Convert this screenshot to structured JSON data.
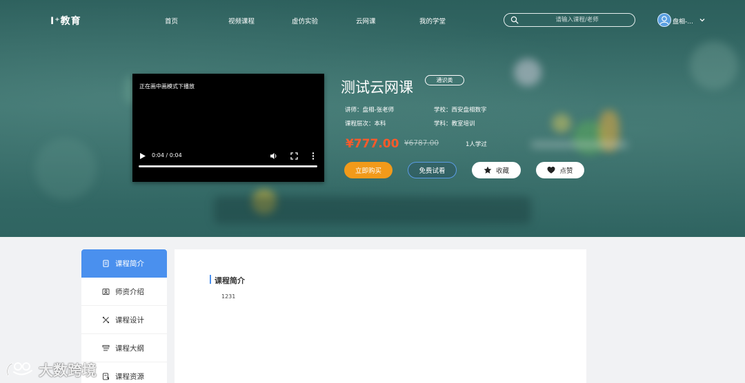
{
  "header": {
    "logo": "I⁺教育",
    "nav": [
      "首页",
      "视频课程",
      "虚仿实验",
      "云网课",
      "我的学堂"
    ],
    "search": {
      "placeholder": "请输入课程/老师"
    },
    "user": {
      "name": "盘相-..."
    }
  },
  "video": {
    "message": "正在画中画模式下播放",
    "time": "0:04 / 0:04"
  },
  "course": {
    "title": "测试云网课",
    "tag": "通识类",
    "teacher": "讲师：盘相-张老师",
    "school": "学校：西安盘相数字",
    "level": "课程层次：本科",
    "subject": "学科：教室培训",
    "price": "¥777.00",
    "original_price": "¥6787.00",
    "learners": "1人学过",
    "buttons": {
      "buy": "立即购买",
      "trial": "免费试看",
      "favorite": "收藏",
      "like": "点赞"
    }
  },
  "sidebar": {
    "items": [
      {
        "label": "课程简介",
        "icon": "intro-icon",
        "active": true
      },
      {
        "label": "师资介绍",
        "icon": "teacher-icon",
        "active": false
      },
      {
        "label": "课程设计",
        "icon": "design-icon",
        "active": false
      },
      {
        "label": "课程大纲",
        "icon": "outline-icon",
        "active": false
      },
      {
        "label": "课程资源",
        "icon": "resource-icon",
        "active": false
      }
    ]
  },
  "content": {
    "title": "课程简介",
    "body": "1231"
  },
  "watermark": {
    "text": "大数跨境"
  },
  "colors": {
    "accent": "#4a90ee",
    "buy": "#f29a1a",
    "price": "#ff5a2a",
    "hero_bg": "#2f6461"
  }
}
